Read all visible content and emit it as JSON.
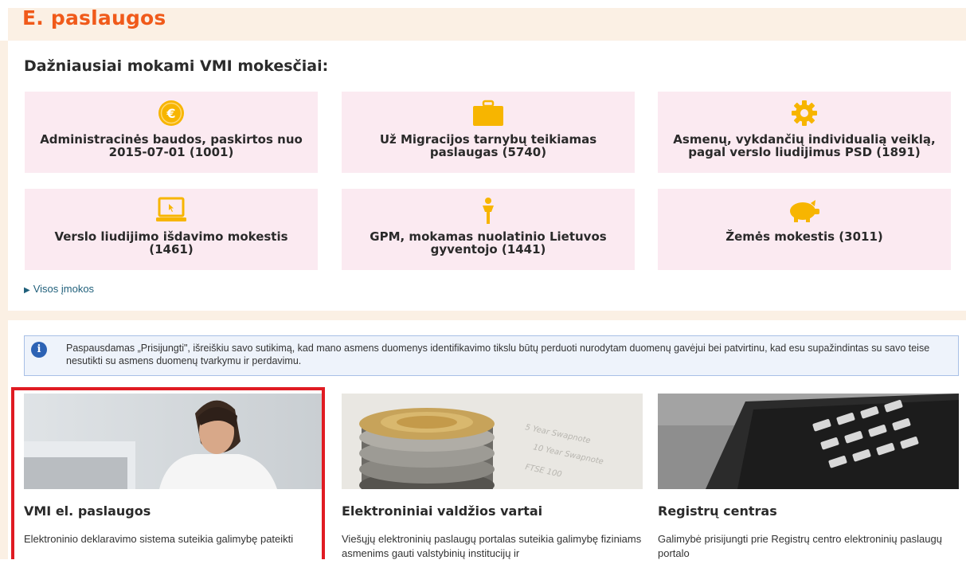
{
  "header": {
    "title": "E. paslaugos"
  },
  "payments": {
    "heading": "Dažniausiai mokami VMI mokesčiai:",
    "tiles": [
      {
        "icon": "euro-coin-icon",
        "label": "Administracinės baudos, paskirtos nuo 2015-07-01 (1001)"
      },
      {
        "icon": "briefcase-icon",
        "label": "Už Migracijos tarnybų teikiamas paslaugas (5740)"
      },
      {
        "icon": "gear-icon",
        "label": "Asmenų, vykdančių individualią veiklą, pagal verslo liudijimus PSD (1891)"
      },
      {
        "icon": "laptop-icon",
        "label": "Verslo liudijimo išdavimo mokestis (1461)"
      },
      {
        "icon": "person-icon",
        "label": "GPM, mokamas nuolatinio Lietuvos gyventojo (1441)"
      },
      {
        "icon": "piggy-bank-icon",
        "label": "Žemės mokestis (3011)"
      }
    ],
    "all_link": "Visos įmokos"
  },
  "notice": {
    "text": "Paspausdamas „Prisijungti\", išreiškiu savo sutikimą, kad mano asmens duomenys identifikavimo tikslu būtų perduoti nurodytam duomenų gavėjui bei patvirtinu, kad esu supažindintas su savo teise nesutikti su asmens duomenų tvarkymu ir perdavimu."
  },
  "services": [
    {
      "title": "VMI el. paslaugos",
      "description": "Elektroninio deklaravimo sistema suteikia galimybę pateikti",
      "image": "man-with-laptop-photo"
    },
    {
      "title": "Elektroniniai valdžios vartai",
      "description": "Viešųjų elektroninių paslaugų portalas suteikia galimybę fiziniams asmenims gauti valstybinių institucijų ir",
      "image": "coins-stack-photo"
    },
    {
      "title": "Registrų centras",
      "description": "Galimybė prisijungti prie Registrų centro elektroninių paslaugų portalo",
      "image": "mobile-phone-photo"
    }
  ],
  "colors": {
    "accent": "#f05a1a",
    "tile_bg": "#fbeaf1",
    "icon": "#f7b500",
    "highlight": "#e01b22",
    "info": "#2c62b4"
  }
}
